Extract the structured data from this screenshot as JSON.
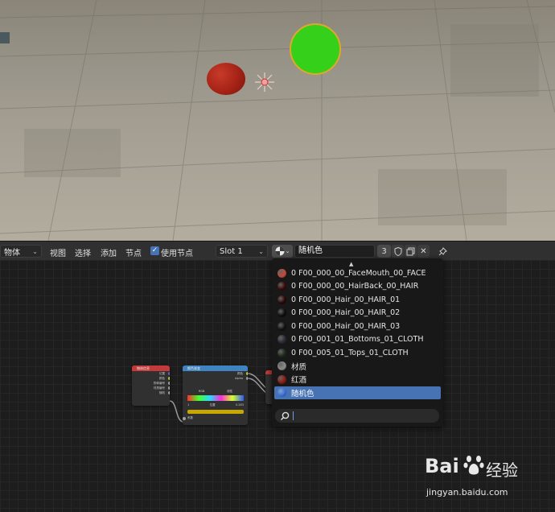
{
  "node_editor": {
    "header": {
      "object_mode_label": "物体",
      "menu_view": "视图",
      "menu_select": "选择",
      "menu_add": "添加",
      "menu_node": "节点",
      "use_nodes_label": "使用节点",
      "slot_label": "Slot 1",
      "material_name": "随机色",
      "user_count": "3"
    },
    "nodes": {
      "object_info": {
        "title": "物体信息",
        "rows": [
          "位置",
          "颜色",
          "物体编号",
          "材质编号",
          "随机"
        ]
      },
      "color_ramp": {
        "title": "颜色渐变",
        "rows": [
          "颜色",
          "Alpha"
        ],
        "mode": "RGB",
        "interp": "线性",
        "index": "1",
        "pos_label": "位置",
        "pos_value": "0.283",
        "factor_label": "系数"
      }
    }
  },
  "material_dropdown": {
    "items": [
      {
        "label": "0 F00_000_00_FaceMouth_00_FACE",
        "swatch": "#c44a3a"
      },
      {
        "label": "0 F00_000_00_HairBack_00_HAIR",
        "swatch": "#3a0808"
      },
      {
        "label": "0 F00_000_Hair_00_HAIR_01",
        "swatch": "#2b0505"
      },
      {
        "label": "0 F00_000_Hair_00_HAIR_02",
        "swatch": "#0c0c0c"
      },
      {
        "label": "0 F00_000_Hair_00_HAIR_03",
        "swatch": "#111111"
      },
      {
        "label": "0 F00_001_01_Bottoms_01_CLOTH",
        "swatch": "#2a2a36"
      },
      {
        "label": "0 F00_005_01_Tops_01_CLOTH",
        "swatch": "#1e2a1a"
      },
      {
        "label": "材质",
        "swatch": "#8a8a8a"
      },
      {
        "label": "红酒",
        "swatch": "#8a1a10"
      },
      {
        "label": "随机色",
        "swatch": "#3b6fd8",
        "active": true
      }
    ],
    "search_value": ""
  },
  "watermark": {
    "brand": "Bai",
    "brand_tail": "经验",
    "url": "jingyan.baidu.com"
  },
  "colors": {
    "accent": "#4772b3",
    "green_sphere": "#35d01a",
    "red_sphere": "#a52316",
    "selection_outline": "#e0a82a"
  }
}
